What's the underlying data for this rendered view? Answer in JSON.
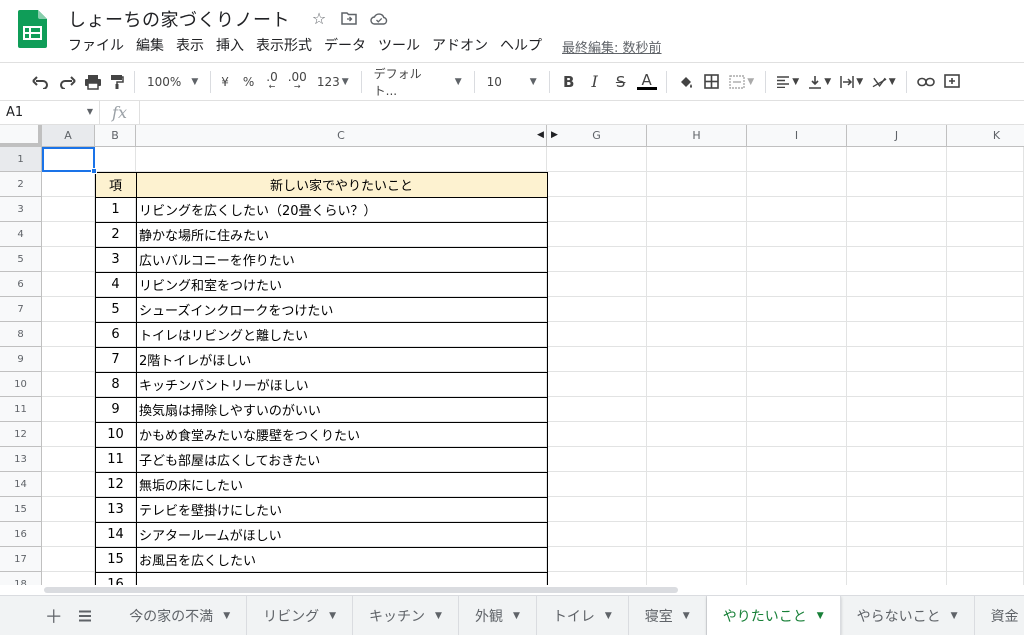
{
  "document": {
    "title": "しょーちの家づくりノート",
    "last_edit": "最終編集: 数秒前"
  },
  "menu": [
    "ファイル",
    "編集",
    "表示",
    "挿入",
    "表示形式",
    "データ",
    "ツール",
    "アドオン",
    "ヘルプ"
  ],
  "toolbar": {
    "zoom": "100%",
    "currency": "¥",
    "percent": "%",
    "dec_decrease": ".0",
    "dec_increase": ".00",
    "more_formats": "123",
    "font": "デフォルト...",
    "font_size": "10",
    "bold": "B",
    "italic": "I",
    "strike": "S",
    "text_color": "A"
  },
  "formula_bar": {
    "name_box": "A1",
    "fx": "fx",
    "value": ""
  },
  "columns": [
    "A",
    "B",
    "C",
    "G",
    "H",
    "I",
    "J",
    "K"
  ],
  "rows": [
    "1",
    "2",
    "3",
    "4",
    "5",
    "6",
    "7",
    "8",
    "9",
    "10",
    "11",
    "12",
    "13",
    "14",
    "15",
    "16",
    "17",
    "18"
  ],
  "table": {
    "header_num": "項",
    "header_text": "新しい家でやりたいこと",
    "items": [
      {
        "n": "1",
        "text": "リビングを広くしたい（20畳くらい？）"
      },
      {
        "n": "2",
        "text": "静かな場所に住みたい"
      },
      {
        "n": "3",
        "text": "広いバルコニーを作りたい"
      },
      {
        "n": "4",
        "text": "リビング和室をつけたい"
      },
      {
        "n": "5",
        "text": "シューズインクロークをつけたい"
      },
      {
        "n": "6",
        "text": "トイレはリビングと離したい"
      },
      {
        "n": "7",
        "text": "2階トイレがほしい"
      },
      {
        "n": "8",
        "text": "キッチンパントリーがほしい"
      },
      {
        "n": "9",
        "text": "換気扇は掃除しやすいのがいい"
      },
      {
        "n": "10",
        "text": "かもめ食堂みたいな腰壁をつくりたい"
      },
      {
        "n": "11",
        "text": "子ども部屋は広くしておきたい"
      },
      {
        "n": "12",
        "text": "無垢の床にしたい"
      },
      {
        "n": "13",
        "text": "テレビを壁掛けにしたい"
      },
      {
        "n": "14",
        "text": "シアタールームがほしい"
      },
      {
        "n": "15",
        "text": "お風呂を広くしたい"
      },
      {
        "n": "16",
        "text": ""
      }
    ]
  },
  "sheet_tabs": [
    {
      "label": "今の家の不満",
      "active": false
    },
    {
      "label": "リビング",
      "active": false
    },
    {
      "label": "キッチン",
      "active": false
    },
    {
      "label": "外観",
      "active": false
    },
    {
      "label": "トイレ",
      "active": false
    },
    {
      "label": "寝室",
      "active": false
    },
    {
      "label": "やりたいこと",
      "active": true
    },
    {
      "label": "やらないこと",
      "active": false
    },
    {
      "label": "資金",
      "active": false
    }
  ],
  "colors": {
    "accent": "#1a73e8",
    "active_tab": "#188038",
    "header_fill": "#fdf2d0",
    "logo_green": "#0f9d58"
  }
}
